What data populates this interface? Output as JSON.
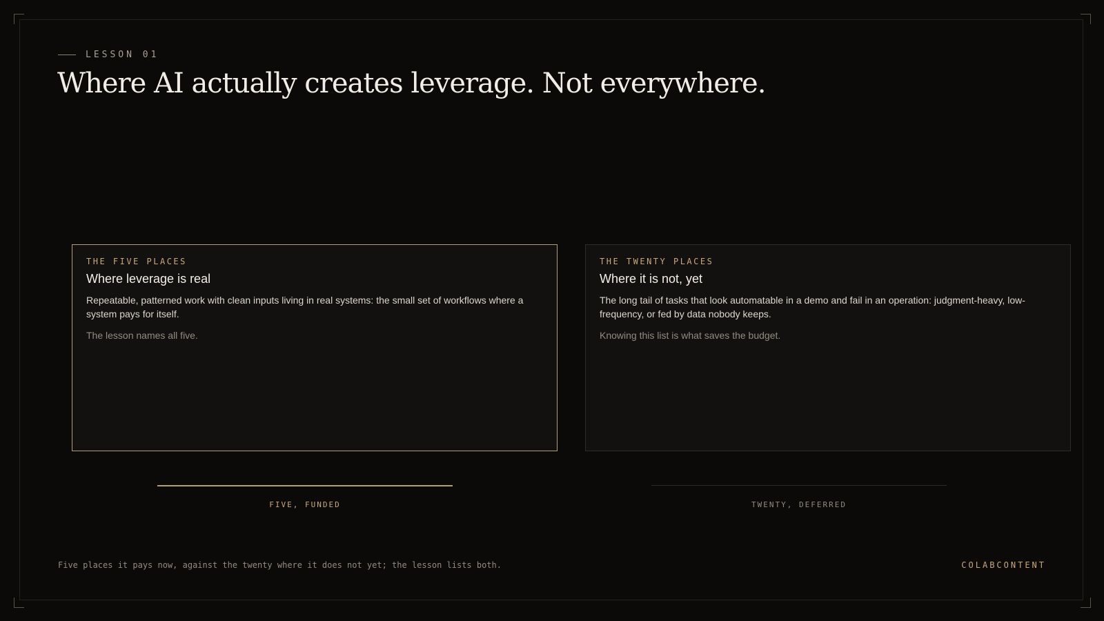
{
  "lesson": {
    "eyebrow": "LESSON 01",
    "title": "Where AI actually creates leverage. Not everywhere."
  },
  "cards": [
    {
      "kicker": "THE FIVE PLACES",
      "heading": "Where leverage is real",
      "body": "Repeatable, patterned work with clean inputs living in real systems: the small set of workflows where a system pays for itself.",
      "note": "The lesson names all five."
    },
    {
      "kicker": "THE TWENTY PLACES",
      "heading": "Where it is not, yet",
      "body": "The long tail of tasks that look automatable in a demo and fail in an operation: judgment-heavy, low-frequency, or fed by data nobody keeps.",
      "note": "Knowing this list is what saves the budget."
    }
  ],
  "bars": [
    {
      "label": "FIVE, FUNDED"
    },
    {
      "label": "TWENTY, DEFERRED"
    }
  ],
  "footer": {
    "caption": "Five places it pays now, against the twenty where it does not yet; the lesson lists both.",
    "brand": "COLABCONTENT"
  },
  "colors": {
    "background": "#0b0a09",
    "accent": "#c8a97e",
    "accent_border": "#b59d7a",
    "muted_border": "#2e2b27"
  }
}
